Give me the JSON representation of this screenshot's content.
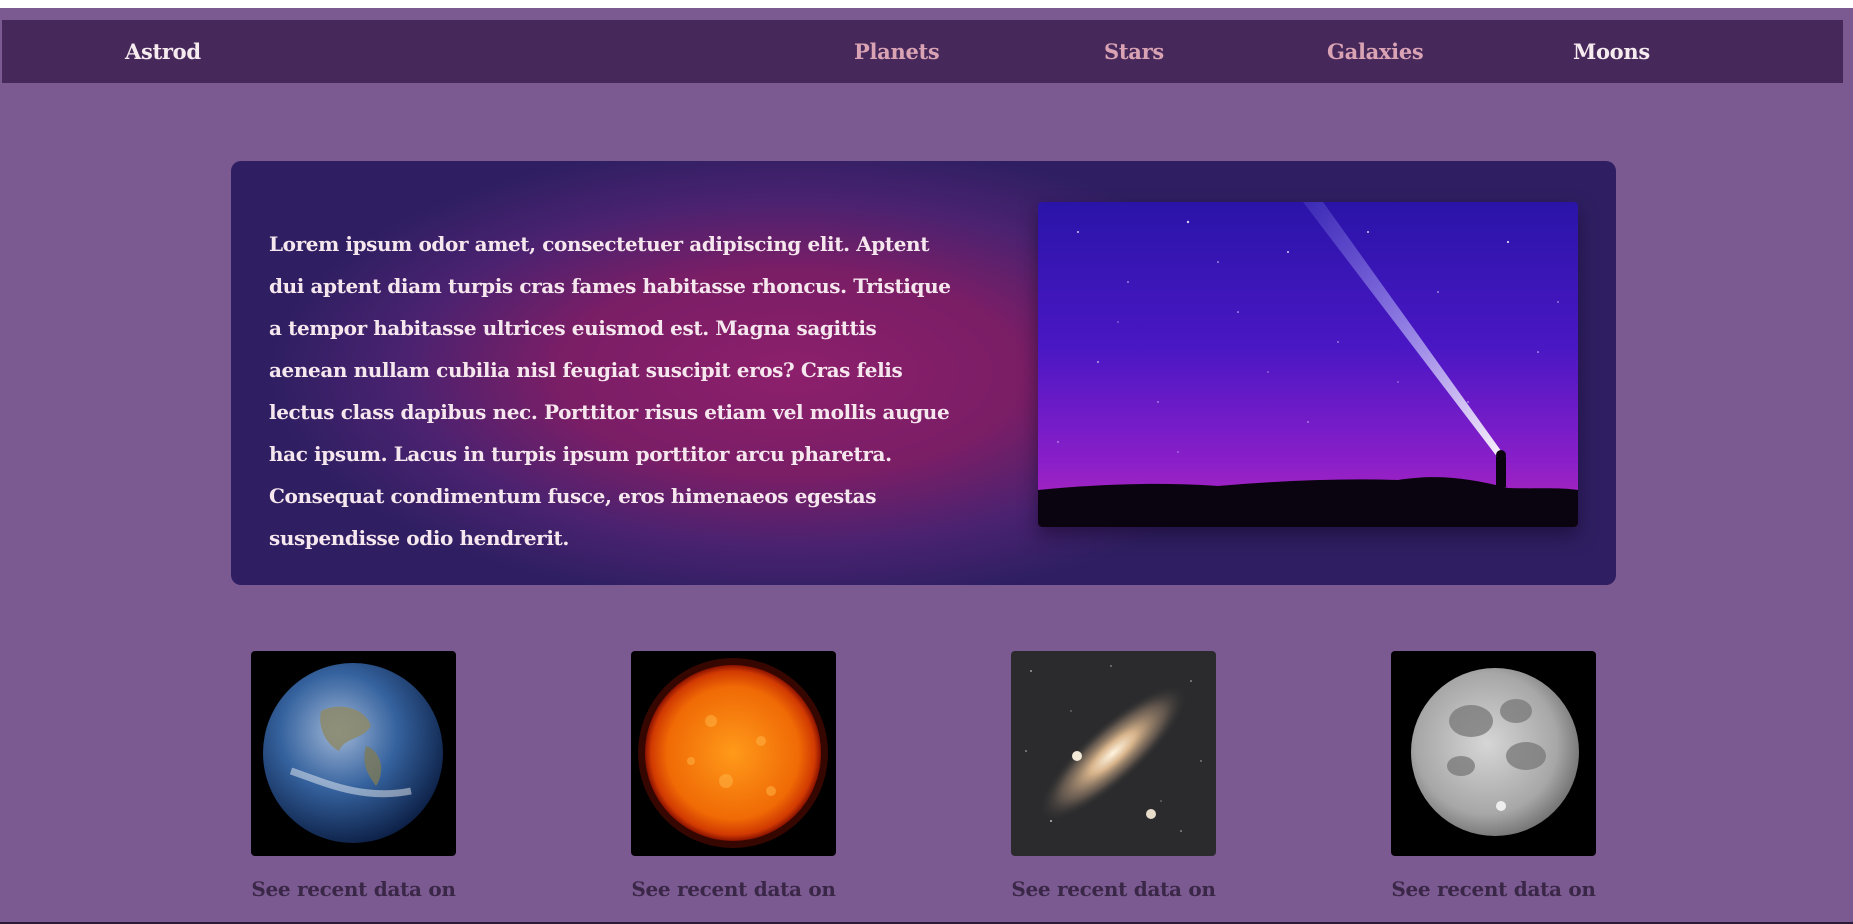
{
  "nav": {
    "brand": "Astrod",
    "links": [
      {
        "label": "Planets",
        "active": false
      },
      {
        "label": "Stars",
        "active": false
      },
      {
        "label": "Galaxies",
        "active": false
      },
      {
        "label": "Moons",
        "active": true
      }
    ]
  },
  "hero": {
    "text": "Lorem ipsum odor amet, consectetuer adipiscing elit. Aptent dui aptent diam turpis cras fames habitasse rhoncus. Tristique a tempor habitasse ultrices euismod est. Magna sagittis aenean nullam cubilia nisl feugiat suscipit eros? Cras felis lectus class dapibus nec. Porttitor risus etiam vel mollis augue hac ipsum. Lacus in turpis ipsum porttitor arcu pharetra. Consequat condimentum fusce, eros himenaeos egestas suspendisse odio hendrerit.",
    "image": "night-sky-flashlight-image"
  },
  "cards": [
    {
      "image": "earth-image",
      "caption": "See recent data on"
    },
    {
      "image": "sun-image",
      "caption": "See recent data on"
    },
    {
      "image": "galaxy-image",
      "caption": "See recent data on"
    },
    {
      "image": "moon-image",
      "caption": "See recent data on"
    }
  ],
  "colors": {
    "page_bg": "#7b5a91",
    "navbar_bg": "#47285b",
    "nav_link": "#d9a3b4",
    "nav_active": "#f6ecef",
    "hero_glow": "#8d1f6c",
    "hero_edge": "#2f1f62",
    "caption": "#3a2747"
  }
}
